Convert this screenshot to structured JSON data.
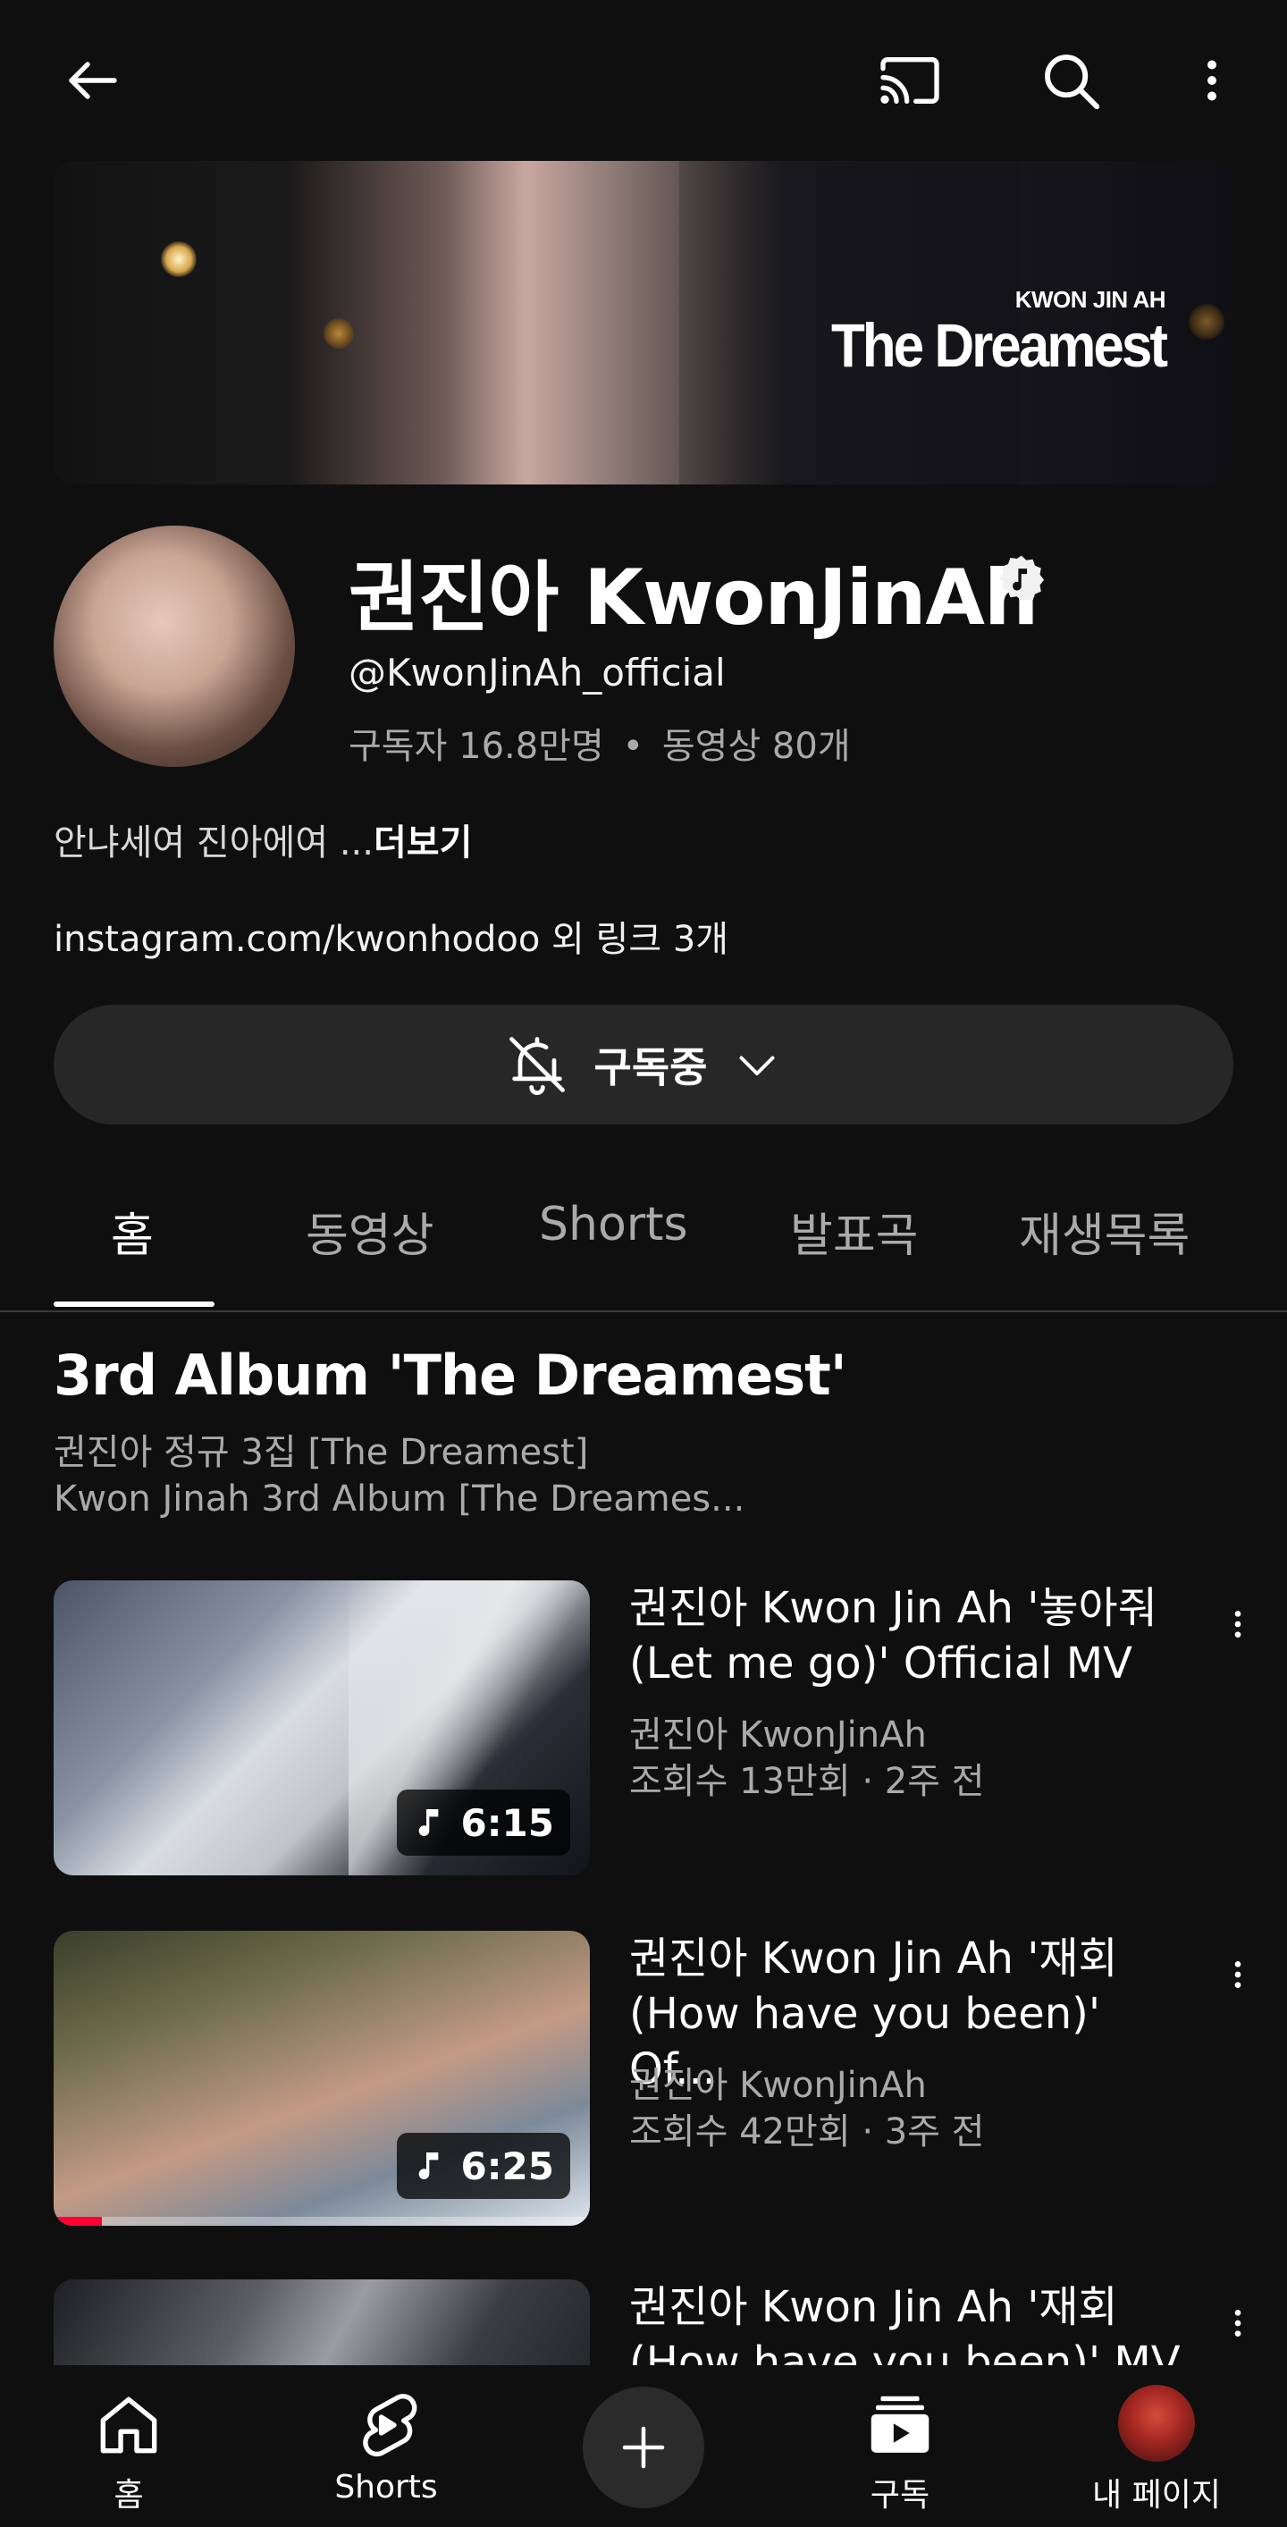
{
  "topbar": {
    "back_icon": "arrow-left-icon",
    "cast_icon": "cast-icon",
    "search_icon": "search-icon",
    "more_icon": "more-vertical-icon"
  },
  "banner": {
    "artist": "KWON JIN AH",
    "album": "The Dreamest"
  },
  "channel": {
    "name": "권진아 KwonJinAh",
    "handle": "@KwonJinAh_official",
    "subscribers": "구독자 16.8만명",
    "videos": "동영상 80개",
    "stats_separator": "•",
    "description": "안냐세여 진아에여 ...",
    "more_label": "더보기",
    "links": "instagram.com/kwonhodoo 외 링크 3개",
    "subscribe_label": "구독중"
  },
  "tabs": [
    {
      "label": "홈",
      "active": true
    },
    {
      "label": "동영상",
      "active": false
    },
    {
      "label": "Shorts",
      "active": false
    },
    {
      "label": "발표곡",
      "active": false
    },
    {
      "label": "재생목록",
      "active": false
    }
  ],
  "section": {
    "title": "3rd Album 'The Dreamest'",
    "subtitle_line1": "권진아 정규 3집 [The Dreamest]",
    "subtitle_line2": "Kwon Jinah 3rd Album [The Dreames..."
  },
  "videos": [
    {
      "title": "권진아 Kwon Jin Ah '놓아줘 (Let me go)' Official MV",
      "channel": "권진아 KwonJinAh",
      "meta": "조회수 13만회 · 2주 전",
      "duration": "6:15",
      "watched_fraction": 0
    },
    {
      "title": "권진아 Kwon Jin Ah '재회 (How have you been)' Of...",
      "channel": "권진아 KwonJinAh",
      "meta": "조회수 42만회 · 3주 전",
      "duration": "6:25",
      "watched_fraction": 0.09
    },
    {
      "title": "권진아 Kwon Jin Ah '재회 (How have you been)' MV",
      "channel": "",
      "meta": "",
      "duration": "",
      "watched_fraction": 0
    }
  ],
  "bottomnav": {
    "home": "홈",
    "shorts": "Shorts",
    "subscriptions": "구독",
    "me": "내 페이지"
  }
}
